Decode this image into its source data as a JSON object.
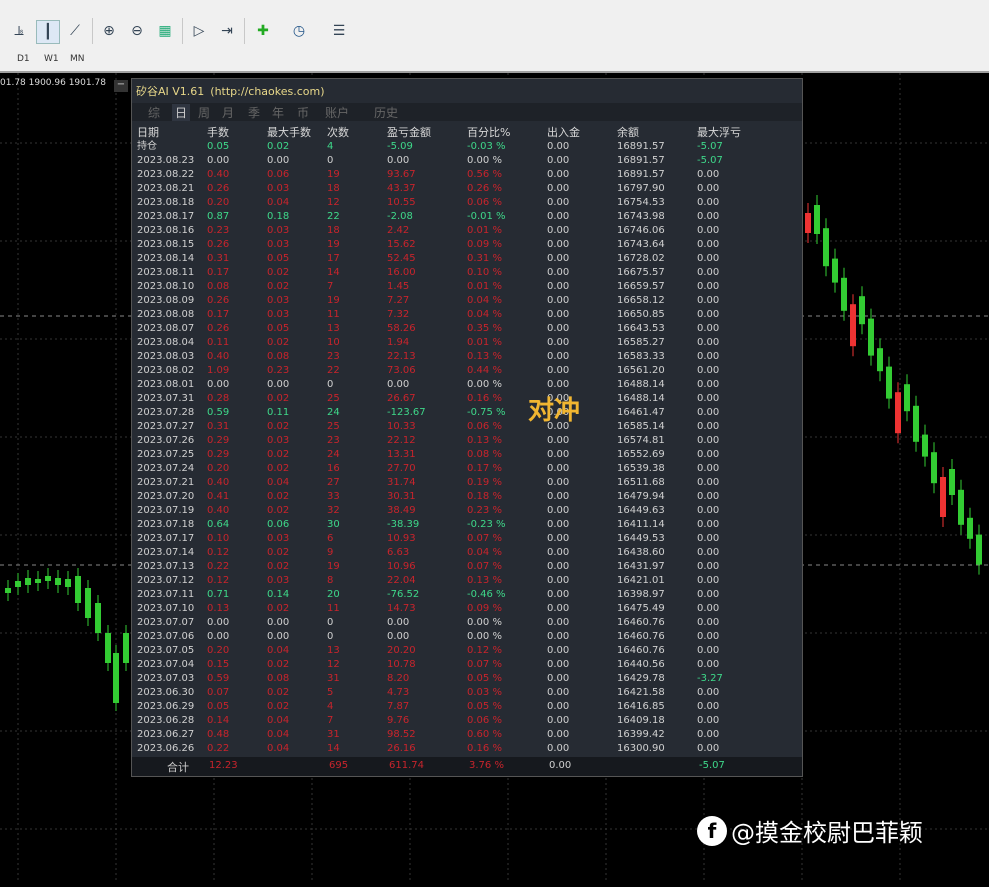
{
  "toolbar": {
    "timeframes": [
      "D1",
      "W1",
      "MN"
    ]
  },
  "price_readout": "01.78 1900.96 1901.78",
  "panel": {
    "title": "矽谷AI V1.61",
    "url": "(http://chaokes.com)",
    "minimize": "−",
    "tabs": [
      "综",
      "日",
      "周",
      "月",
      "季",
      "年",
      "币",
      "账户",
      "历史"
    ],
    "active_tab": "日",
    "headers": [
      "日期",
      "手数",
      "最大手数",
      "次数",
      "盈亏金额",
      "百分比%",
      "出入金",
      "余额",
      "最大浮亏"
    ],
    "rows": [
      [
        "持仓",
        "0.05",
        "0.02",
        "4",
        "-5.09",
        "-0.03 %",
        "0.00",
        "16891.57",
        "-5.07",
        "g",
        "g"
      ],
      [
        "2023.08.23",
        "0.00",
        "0.00",
        "0",
        "0.00",
        "0.00 %",
        "0.00",
        "16891.57",
        "-5.07",
        "w",
        "g"
      ],
      [
        "2023.08.22",
        "0.40",
        "0.06",
        "19",
        "93.67",
        "0.56 %",
        "0.00",
        "16891.57",
        "0.00",
        "r",
        "w"
      ],
      [
        "2023.08.21",
        "0.26",
        "0.03",
        "18",
        "43.37",
        "0.26 %",
        "0.00",
        "16797.90",
        "0.00",
        "r",
        "w"
      ],
      [
        "2023.08.18",
        "0.20",
        "0.04",
        "12",
        "10.55",
        "0.06 %",
        "0.00",
        "16754.53",
        "0.00",
        "r",
        "w"
      ],
      [
        "2023.08.17",
        "0.87",
        "0.18",
        "22",
        "-2.08",
        "-0.01 %",
        "0.00",
        "16743.98",
        "0.00",
        "g",
        "w"
      ],
      [
        "2023.08.16",
        "0.23",
        "0.03",
        "18",
        "2.42",
        "0.01 %",
        "0.00",
        "16746.06",
        "0.00",
        "r",
        "w"
      ],
      [
        "2023.08.15",
        "0.26",
        "0.03",
        "19",
        "15.62",
        "0.09 %",
        "0.00",
        "16743.64",
        "0.00",
        "r",
        "w"
      ],
      [
        "2023.08.14",
        "0.31",
        "0.05",
        "17",
        "52.45",
        "0.31 %",
        "0.00",
        "16728.02",
        "0.00",
        "r",
        "w"
      ],
      [
        "2023.08.11",
        "0.17",
        "0.02",
        "14",
        "16.00",
        "0.10 %",
        "0.00",
        "16675.57",
        "0.00",
        "r",
        "w"
      ],
      [
        "2023.08.10",
        "0.08",
        "0.02",
        "7",
        "1.45",
        "0.01 %",
        "0.00",
        "16659.57",
        "0.00",
        "r",
        "w"
      ],
      [
        "2023.08.09",
        "0.26",
        "0.03",
        "19",
        "7.27",
        "0.04 %",
        "0.00",
        "16658.12",
        "0.00",
        "r",
        "w"
      ],
      [
        "2023.08.08",
        "0.17",
        "0.03",
        "11",
        "7.32",
        "0.04 %",
        "0.00",
        "16650.85",
        "0.00",
        "r",
        "w"
      ],
      [
        "2023.08.07",
        "0.26",
        "0.05",
        "13",
        "58.26",
        "0.35 %",
        "0.00",
        "16643.53",
        "0.00",
        "r",
        "w"
      ],
      [
        "2023.08.04",
        "0.11",
        "0.02",
        "10",
        "1.94",
        "0.01 %",
        "0.00",
        "16585.27",
        "0.00",
        "r",
        "w"
      ],
      [
        "2023.08.03",
        "0.40",
        "0.08",
        "23",
        "22.13",
        "0.13 %",
        "0.00",
        "16583.33",
        "0.00",
        "r",
        "w"
      ],
      [
        "2023.08.02",
        "1.09",
        "0.23",
        "22",
        "73.06",
        "0.44 %",
        "0.00",
        "16561.20",
        "0.00",
        "r",
        "w"
      ],
      [
        "2023.08.01",
        "0.00",
        "0.00",
        "0",
        "0.00",
        "0.00 %",
        "0.00",
        "16488.14",
        "0.00",
        "w",
        "w"
      ],
      [
        "2023.07.31",
        "0.28",
        "0.02",
        "25",
        "26.67",
        "0.16 %",
        "0.00",
        "16488.14",
        "0.00",
        "r",
        "w"
      ],
      [
        "2023.07.28",
        "0.59",
        "0.11",
        "24",
        "-123.67",
        "-0.75 %",
        "0.00",
        "16461.47",
        "0.00",
        "g",
        "w"
      ],
      [
        "2023.07.27",
        "0.31",
        "0.02",
        "25",
        "10.33",
        "0.06 %",
        "0.00",
        "16585.14",
        "0.00",
        "r",
        "w"
      ],
      [
        "2023.07.26",
        "0.29",
        "0.03",
        "23",
        "22.12",
        "0.13 %",
        "0.00",
        "16574.81",
        "0.00",
        "r",
        "w"
      ],
      [
        "2023.07.25",
        "0.29",
        "0.02",
        "24",
        "13.31",
        "0.08 %",
        "0.00",
        "16552.69",
        "0.00",
        "r",
        "w"
      ],
      [
        "2023.07.24",
        "0.20",
        "0.02",
        "16",
        "27.70",
        "0.17 %",
        "0.00",
        "16539.38",
        "0.00",
        "r",
        "w"
      ],
      [
        "2023.07.21",
        "0.40",
        "0.04",
        "27",
        "31.74",
        "0.19 %",
        "0.00",
        "16511.68",
        "0.00",
        "r",
        "w"
      ],
      [
        "2023.07.20",
        "0.41",
        "0.02",
        "33",
        "30.31",
        "0.18 %",
        "0.00",
        "16479.94",
        "0.00",
        "r",
        "w"
      ],
      [
        "2023.07.19",
        "0.40",
        "0.02",
        "32",
        "38.49",
        "0.23 %",
        "0.00",
        "16449.63",
        "0.00",
        "r",
        "w"
      ],
      [
        "2023.07.18",
        "0.64",
        "0.06",
        "30",
        "-38.39",
        "-0.23 %",
        "0.00",
        "16411.14",
        "0.00",
        "g",
        "w"
      ],
      [
        "2023.07.17",
        "0.10",
        "0.03",
        "6",
        "10.93",
        "0.07 %",
        "0.00",
        "16449.53",
        "0.00",
        "r",
        "w"
      ],
      [
        "2023.07.14",
        "0.12",
        "0.02",
        "9",
        "6.63",
        "0.04 %",
        "0.00",
        "16438.60",
        "0.00",
        "r",
        "w"
      ],
      [
        "2023.07.13",
        "0.22",
        "0.02",
        "19",
        "10.96",
        "0.07 %",
        "0.00",
        "16431.97",
        "0.00",
        "r",
        "w"
      ],
      [
        "2023.07.12",
        "0.12",
        "0.03",
        "8",
        "22.04",
        "0.13 %",
        "0.00",
        "16421.01",
        "0.00",
        "r",
        "w"
      ],
      [
        "2023.07.11",
        "0.71",
        "0.14",
        "20",
        "-76.52",
        "-0.46 %",
        "0.00",
        "16398.97",
        "0.00",
        "g",
        "w"
      ],
      [
        "2023.07.10",
        "0.13",
        "0.02",
        "11",
        "14.73",
        "0.09 %",
        "0.00",
        "16475.49",
        "0.00",
        "r",
        "w"
      ],
      [
        "2023.07.07",
        "0.00",
        "0.00",
        "0",
        "0.00",
        "0.00 %",
        "0.00",
        "16460.76",
        "0.00",
        "w",
        "w"
      ],
      [
        "2023.07.06",
        "0.00",
        "0.00",
        "0",
        "0.00",
        "0.00 %",
        "0.00",
        "16460.76",
        "0.00",
        "w",
        "w"
      ],
      [
        "2023.07.05",
        "0.20",
        "0.04",
        "13",
        "20.20",
        "0.12 %",
        "0.00",
        "16460.76",
        "0.00",
        "r",
        "w"
      ],
      [
        "2023.07.04",
        "0.15",
        "0.02",
        "12",
        "10.78",
        "0.07 %",
        "0.00",
        "16440.56",
        "0.00",
        "r",
        "w"
      ],
      [
        "2023.07.03",
        "0.59",
        "0.08",
        "31",
        "8.20",
        "0.05 %",
        "0.00",
        "16429.78",
        "-3.27",
        "r",
        "g"
      ],
      [
        "2023.06.30",
        "0.07",
        "0.02",
        "5",
        "4.73",
        "0.03 %",
        "0.00",
        "16421.58",
        "0.00",
        "r",
        "w"
      ],
      [
        "2023.06.29",
        "0.05",
        "0.02",
        "4",
        "7.87",
        "0.05 %",
        "0.00",
        "16416.85",
        "0.00",
        "r",
        "w"
      ],
      [
        "2023.06.28",
        "0.14",
        "0.04",
        "7",
        "9.76",
        "0.06 %",
        "0.00",
        "16409.18",
        "0.00",
        "r",
        "w"
      ],
      [
        "2023.06.27",
        "0.48",
        "0.04",
        "31",
        "98.52",
        "0.60 %",
        "0.00",
        "16399.42",
        "0.00",
        "r",
        "w"
      ],
      [
        "2023.06.26",
        "0.22",
        "0.04",
        "14",
        "26.16",
        "0.16 %",
        "0.00",
        "16300.90",
        "0.00",
        "r",
        "w"
      ]
    ],
    "footer": {
      "label": "合计",
      "lots": "12.23",
      "count": "695",
      "pnl": "611.74",
      "pct": "3.76 %",
      "io": "0.00",
      "float": "-5.07"
    }
  },
  "watermark": "对冲",
  "brand": {
    "logo": "f",
    "text": "@摸金校尉巴菲颖"
  },
  "colors": {
    "red": "#c8242c",
    "green": "#3ed88a",
    "panel_bg": "#262b33",
    "title": "#e8d88a"
  }
}
